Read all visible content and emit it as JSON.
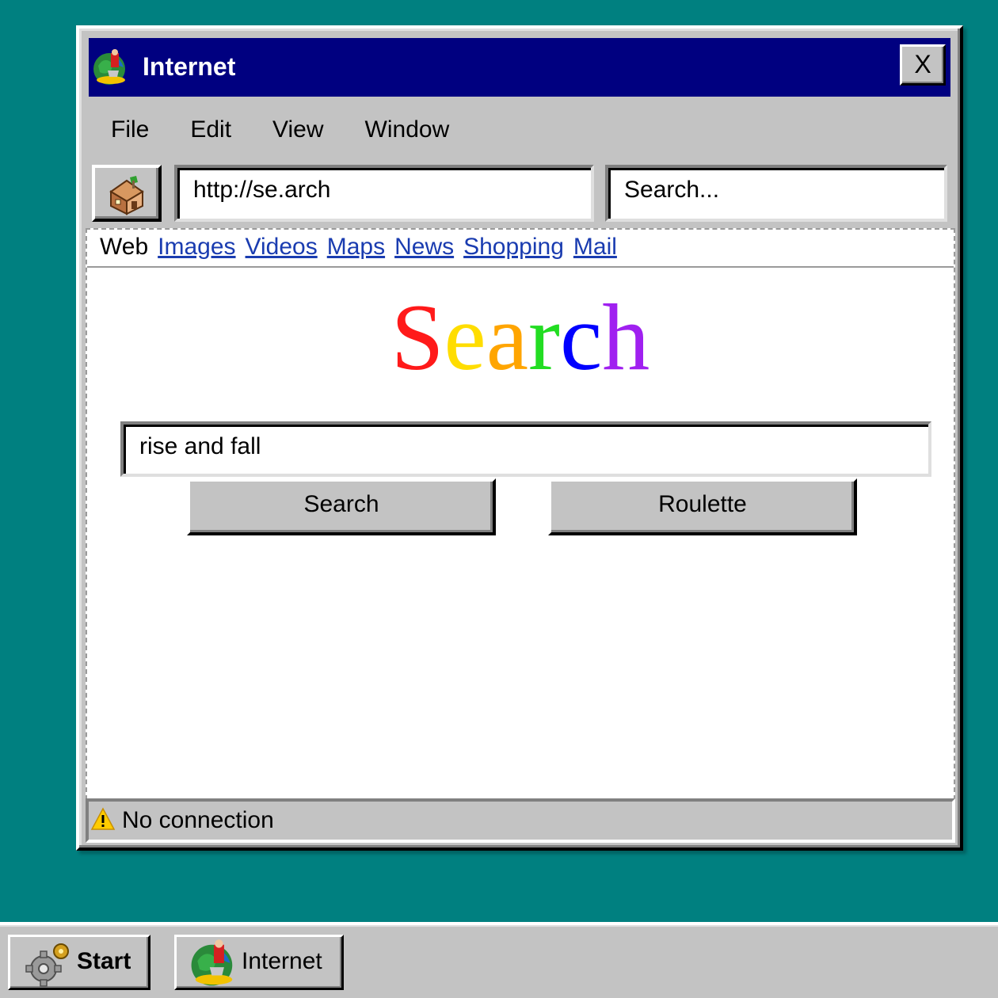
{
  "window": {
    "title": "Internet",
    "close_label": "X"
  },
  "menu": [
    "File",
    "Edit",
    "View",
    "Window"
  ],
  "toolbar": {
    "url": "http://se.arch",
    "search_placeholder": "Search..."
  },
  "page": {
    "nav": {
      "current": "Web",
      "links": [
        "Images",
        "Videos",
        "Maps",
        "News",
        "Shopping",
        "Mail"
      ]
    },
    "logo_letters": [
      "S",
      "e",
      "a",
      "r",
      "c",
      "h"
    ],
    "logo_colors": [
      "#ff1a1a",
      "#ffdd00",
      "#ffa500",
      "#22dd22",
      "#0000ff",
      "#a020f0"
    ],
    "search_value": "rise and fall",
    "search_button": "Search",
    "roulette_button": "Roulette"
  },
  "status": {
    "text": "No connection",
    "icon": "warning-icon"
  },
  "taskbar": {
    "start_label": "Start",
    "task_label": "Internet"
  },
  "colors": {
    "desktop": "#008080",
    "titlebar": "#000080",
    "chrome": "#c3c3c3",
    "link": "#1a3cb0"
  }
}
